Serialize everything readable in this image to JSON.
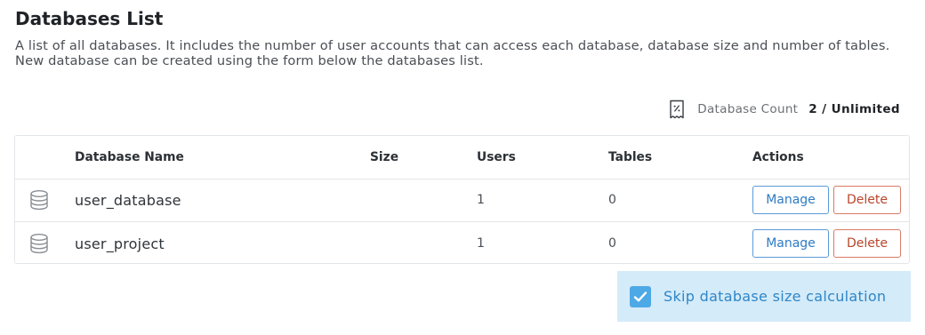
{
  "header": {
    "title": "Databases List",
    "description": "A list of all databases. It includes the number of user accounts that can access each database, database size and number of tables. New database can be created using the form below the databases list."
  },
  "database_count": {
    "icon": "database-count-icon",
    "label": "Database Count",
    "value": "2 / Unlimited"
  },
  "table": {
    "columns": [
      "Database Name",
      "Size",
      "Users",
      "Tables",
      "Actions"
    ],
    "rows": [
      {
        "name": "user_database",
        "size": "",
        "users": "1",
        "tables": "0",
        "manage": "Manage",
        "delete": "Delete"
      },
      {
        "name": "user_project",
        "size": "",
        "users": "1",
        "tables": "0",
        "manage": "Manage",
        "delete": "Delete"
      }
    ]
  },
  "skip_option": {
    "label": "Skip database size calculation",
    "checked": true
  },
  "colors": {
    "manage": "#2f7bc3",
    "delete": "#b8452a",
    "checkbox": "#4da9e6",
    "skip_bg": "#d4ebf9"
  }
}
